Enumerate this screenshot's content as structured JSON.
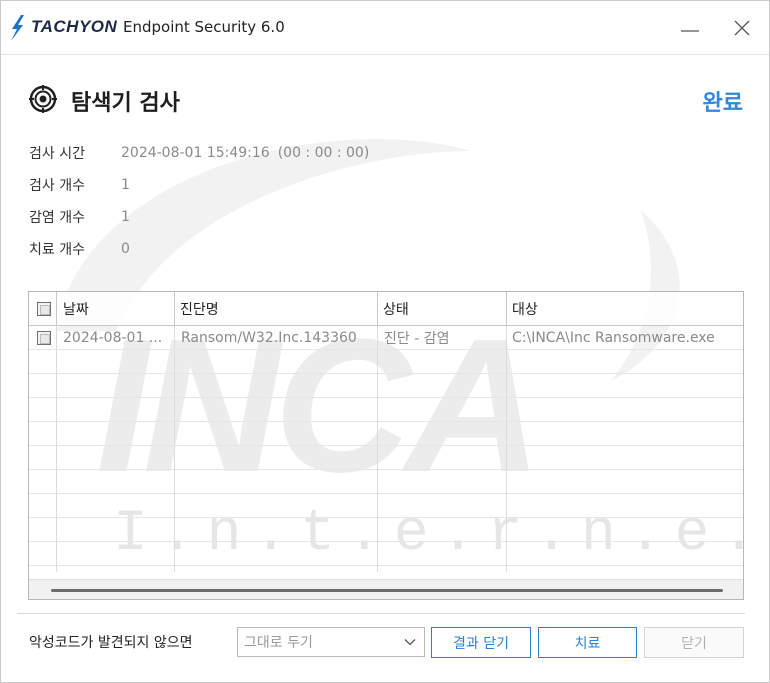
{
  "titlebar": {
    "brand": "TACHYON",
    "app_title": "Endpoint Security 6.0",
    "minimize_icon": "minimize-icon",
    "close_icon": "close-icon"
  },
  "header": {
    "title": "탐색기 검사",
    "status": "완료",
    "icon": "scan-target-icon"
  },
  "info": [
    {
      "label": "검사 시간",
      "value": "2024-08-01 15:49:16",
      "extra": "(00 : 00 : 00)"
    },
    {
      "label": "검사 개수",
      "value": "1"
    },
    {
      "label": "감염 개수",
      "value": "1"
    },
    {
      "label": "치료 개수",
      "value": "0"
    }
  ],
  "table": {
    "columns": [
      "날짜",
      "진단명",
      "상태",
      "대상"
    ],
    "rows": [
      {
        "date": "2024-08-01 ...",
        "name": "Ransom/W32.Inc.143360",
        "status": "진단 - 감염",
        "target": "C:\\INCA\\Inc Ransomware.exe"
      }
    ]
  },
  "watermark": {
    "logo": "INCA",
    "tagline": "I.n.t.e.r.n.e.t"
  },
  "footer": {
    "label": "악성코드가 발견되지 않으면",
    "select_value": "그대로 두기",
    "buttons": {
      "result": "결과 닫기",
      "cure": "치료",
      "close": "닫기"
    }
  },
  "colors": {
    "accent": "#2f88d8",
    "brand": "#1b2a48",
    "bolt": "#1c74c9"
  }
}
